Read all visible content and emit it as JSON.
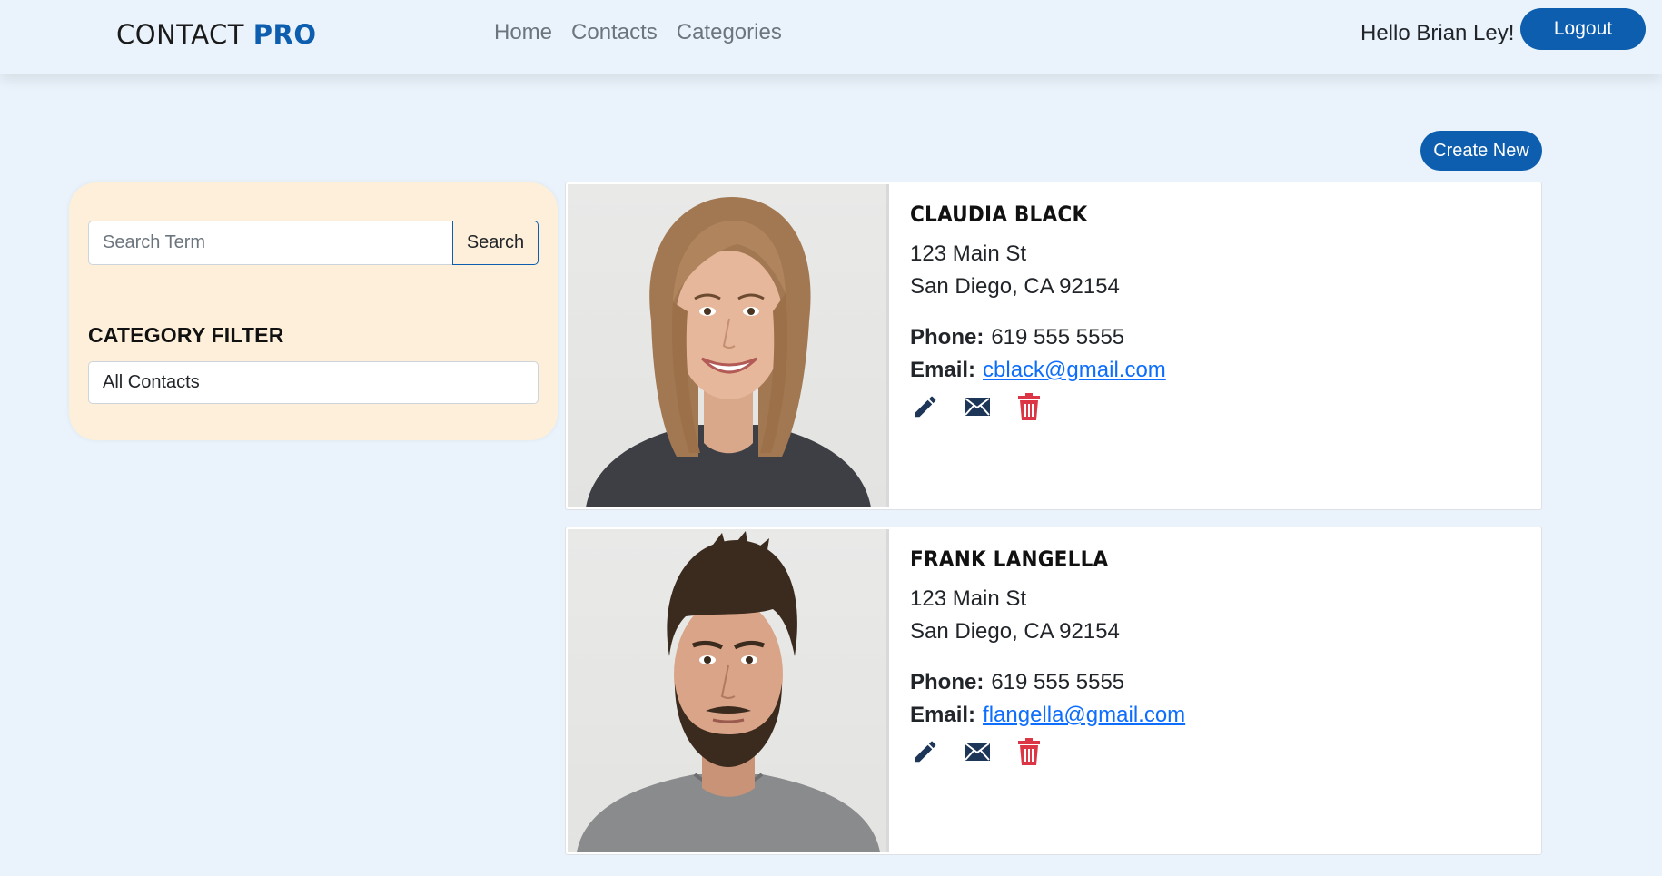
{
  "navbar": {
    "brand_main": "CONTACT",
    "brand_accent": "PRO",
    "links": [
      {
        "label": "Home"
      },
      {
        "label": "Contacts"
      },
      {
        "label": "Categories"
      }
    ],
    "greeting": "Hello Brian Ley!",
    "logout_label": "Logout"
  },
  "toolbar": {
    "create_label": "Create New"
  },
  "sidebar": {
    "search_placeholder": "Search Term",
    "search_value": "",
    "search_label": "Search",
    "filter_title": "CATEGORY FILTER",
    "filter_selected": "All Contacts"
  },
  "contacts": [
    {
      "name": "CLAUDIA BLACK",
      "address1": "123 Main St",
      "address2": "San Diego, CA 92154",
      "phone_label": "Phone:",
      "phone": "619 555 5555",
      "email_label": "Email:",
      "email": "cblack@gmail.com"
    },
    {
      "name": "FRANK LANGELLA",
      "address1": "123 Main St",
      "address2": "San Diego, CA 92154",
      "phone_label": "Phone:",
      "phone": "619 555 5555",
      "email_label": "Email:",
      "email": "flangella@gmail.com"
    }
  ],
  "icons": {
    "edit": "pencil-icon",
    "email": "envelope-icon",
    "delete": "trash-icon"
  },
  "colors": {
    "primary": "#0d5eae",
    "page_bg": "#eaf3fb",
    "sidebar_bg": "#fdefd9",
    "link": "#0d6efd",
    "icon_dark": "#1d3557",
    "danger": "#dc3545"
  }
}
